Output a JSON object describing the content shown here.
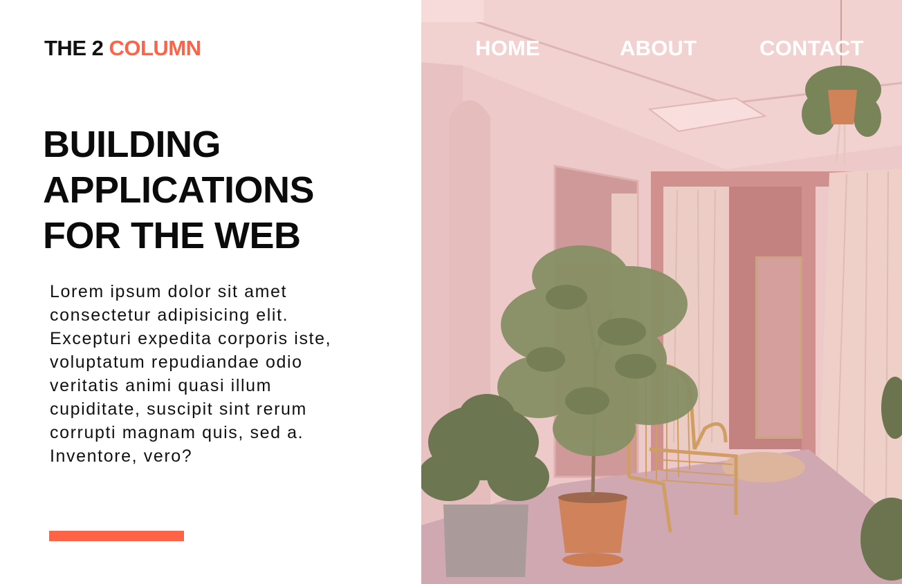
{
  "brand": {
    "part1": "THE 2 ",
    "part2": "COLUMN",
    "accent_color": "#ff6347"
  },
  "nav": {
    "home": "HOME",
    "about": "ABOUT",
    "contact": "CONTACT"
  },
  "hero": {
    "headline_lines": [
      "BUILDING",
      "APPLICATIONS",
      "FOR THE WEB"
    ],
    "body": "Lorem ipsum dolor sit amet consectetur adipisicing elit. Excepturi expedita corporis iste, voluptatum repudiandae odio veritatis animi quasi illum cupiditate, suscipit sint rerum corrupti magnam quis, sed a. Inventore, vero?",
    "image": "pink-room-with-plants-and-rattan-chair"
  }
}
